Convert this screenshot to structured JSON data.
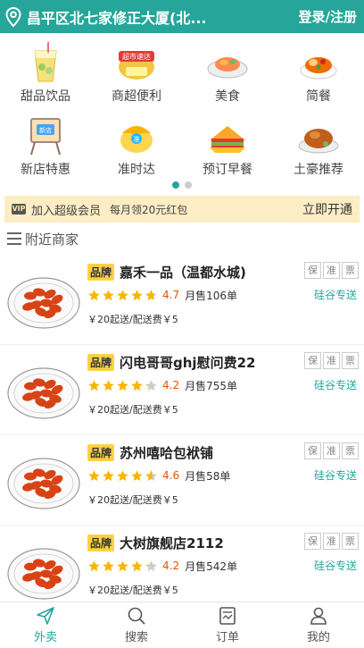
{
  "header": {
    "address": "昌平区北七家修正大厦(北...",
    "login_label": "登录/注册"
  },
  "categories": [
    {
      "label": "甜品饮品",
      "icon": "dessert-drink-icon"
    },
    {
      "label": "商超便利",
      "icon": "supermarket-icon"
    },
    {
      "label": "美食",
      "icon": "food-icon"
    },
    {
      "label": "简餐",
      "icon": "simple-meal-icon"
    },
    {
      "label": "新店特惠",
      "icon": "new-store-icon"
    },
    {
      "label": "准时达",
      "icon": "on-time-icon"
    },
    {
      "label": "预订早餐",
      "icon": "breakfast-icon"
    },
    {
      "label": "土豪推荐",
      "icon": "premium-pick-icon"
    }
  ],
  "pager": {
    "pages": 2,
    "active": 1
  },
  "vip": {
    "badge": "VIP",
    "title": "加入超级会员",
    "subtitle": "每月领20元红包",
    "action": "立即开通"
  },
  "section_title": "附近商家",
  "shops": [
    {
      "brand": "品牌",
      "name": "嘉禾一品（温都水城)",
      "rating": 4.7,
      "rating_text": "4.7",
      "sales": "月售106单",
      "fee": "￥20起送/配送费￥5",
      "tags": [
        "保",
        "准",
        "票"
      ],
      "delivery": "硅谷专送"
    },
    {
      "brand": "品牌",
      "name": "闪电哥哥ghj慰问费22",
      "rating": 4.2,
      "rating_text": "4.2",
      "sales": "月售755单",
      "fee": "￥20起送/配送费￥5",
      "tags": [
        "保",
        "准",
        "票"
      ],
      "delivery": "硅谷专送"
    },
    {
      "brand": "品牌",
      "name": "苏州嘻哈包袱铺",
      "rating": 4.6,
      "rating_text": "4.6",
      "sales": "月售58单",
      "fee": "￥20起送/配送费￥5",
      "tags": [
        "保",
        "准",
        "票"
      ],
      "delivery": "硅谷专送"
    },
    {
      "brand": "品牌",
      "name": "大树旗舰店2112",
      "rating": 4.2,
      "rating_text": "4.2",
      "sales": "月售542单",
      "fee": "￥20起送/配送费￥5",
      "tags": [
        "保",
        "准",
        "票"
      ],
      "delivery": "硅谷专送"
    }
  ],
  "tabbar": [
    {
      "label": "外卖",
      "icon": "send-icon",
      "active": true
    },
    {
      "label": "搜索",
      "icon": "search-icon",
      "active": false
    },
    {
      "label": "订单",
      "icon": "order-icon",
      "active": false
    },
    {
      "label": "我的",
      "icon": "profile-icon",
      "active": false
    }
  ],
  "colors": {
    "primary": "#26a69a",
    "star": "#f7b500",
    "brand_badge": "#ffd146",
    "vip_bg": "#fcedc5",
    "score": "#e65100"
  }
}
